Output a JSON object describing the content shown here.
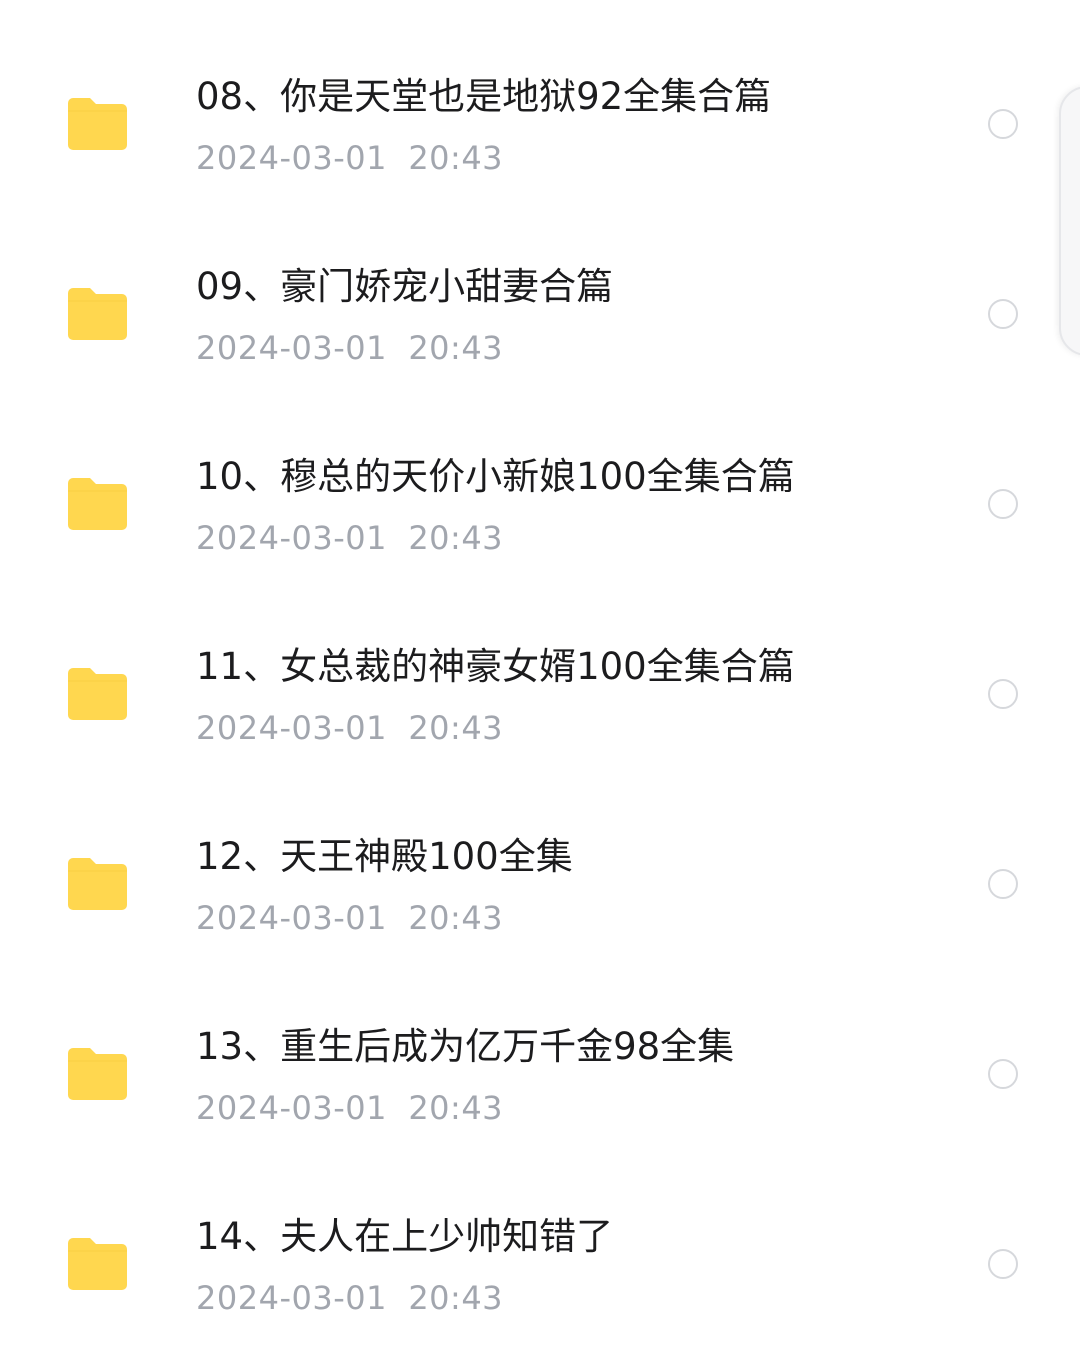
{
  "theme": {
    "folder_color": "#FFD74F",
    "title_color": "#1c1c1e",
    "meta_color": "#a2a6ae",
    "radio_border": "#d6d8dc"
  },
  "files": [
    {
      "name": "08、你是天堂也是地狱92全集合篇",
      "date": "2024-03-01",
      "time": "20:43",
      "icon": "folder-icon"
    },
    {
      "name": "09、豪门娇宠小甜妻合篇",
      "date": "2024-03-01",
      "time": "20:43",
      "icon": "folder-icon"
    },
    {
      "name": "10、穆总的天价小新娘100全集合篇",
      "date": "2024-03-01",
      "time": "20:43",
      "icon": "folder-icon"
    },
    {
      "name": "11、女总裁的神豪女婿100全集合篇",
      "date": "2024-03-01",
      "time": "20:43",
      "icon": "folder-icon"
    },
    {
      "name": "12、天王神殿100全集",
      "date": "2024-03-01",
      "time": "20:43",
      "icon": "folder-icon"
    },
    {
      "name": "13、重生后成为亿万千金98全集",
      "date": "2024-03-01",
      "time": "20:43",
      "icon": "folder-icon"
    },
    {
      "name": "14、夫人在上少帅知错了",
      "date": "2024-03-01",
      "time": "20:43",
      "icon": "folder-icon"
    }
  ]
}
